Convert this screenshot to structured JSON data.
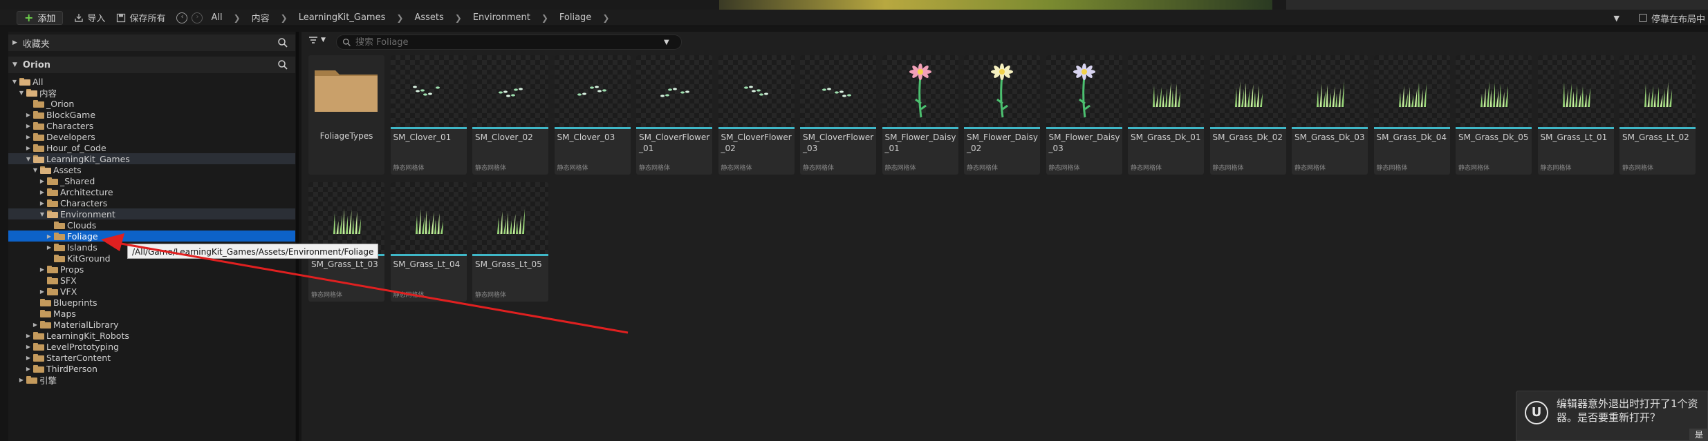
{
  "toolbar": {
    "add_label": "添加",
    "import_label": "导入",
    "save_all_label": "保存所有",
    "breadcrumbs": [
      "All",
      "内容",
      "LearningKit_Games",
      "Assets",
      "Environment",
      "Foliage"
    ],
    "dock_label": "停靠在布局中"
  },
  "left": {
    "favorites_label": "收藏夹",
    "root_label": "Orion",
    "tree": [
      {
        "label": "All",
        "depth": 0,
        "expanded": true,
        "arrow": "open"
      },
      {
        "label": "内容",
        "depth": 1,
        "expanded": true,
        "arrow": "open"
      },
      {
        "label": "_Orion",
        "depth": 2,
        "arrow": "none"
      },
      {
        "label": "BlockGame",
        "depth": 2,
        "arrow": "closed"
      },
      {
        "label": "Characters",
        "depth": 2,
        "arrow": "closed"
      },
      {
        "label": "Developers",
        "depth": 2,
        "arrow": "closed"
      },
      {
        "label": "Hour_of_Code",
        "depth": 2,
        "arrow": "closed"
      },
      {
        "label": "LearningKit_Games",
        "depth": 2,
        "arrow": "open",
        "highlight": true
      },
      {
        "label": "Assets",
        "depth": 3,
        "arrow": "open"
      },
      {
        "label": "_Shared",
        "depth": 4,
        "arrow": "closed"
      },
      {
        "label": "Architecture",
        "depth": 4,
        "arrow": "closed"
      },
      {
        "label": "Characters",
        "depth": 4,
        "arrow": "closed"
      },
      {
        "label": "Environment",
        "depth": 4,
        "arrow": "open",
        "highlight": true
      },
      {
        "label": "Clouds",
        "depth": 5,
        "arrow": "none"
      },
      {
        "label": "Foliage",
        "depth": 5,
        "arrow": "closed",
        "selected": true
      },
      {
        "label": "Islands",
        "depth": 5,
        "arrow": "closed"
      },
      {
        "label": "KitGround",
        "depth": 5,
        "arrow": "none"
      },
      {
        "label": "Props",
        "depth": 4,
        "arrow": "closed"
      },
      {
        "label": "SFX",
        "depth": 4,
        "arrow": "none"
      },
      {
        "label": "VFX",
        "depth": 4,
        "arrow": "closed"
      },
      {
        "label": "Blueprints",
        "depth": 3,
        "arrow": "none"
      },
      {
        "label": "Maps",
        "depth": 3,
        "arrow": "none"
      },
      {
        "label": "MaterialLibrary",
        "depth": 3,
        "arrow": "closed"
      },
      {
        "label": "LearningKit_Robots",
        "depth": 2,
        "arrow": "closed"
      },
      {
        "label": "LevelPrototyping",
        "depth": 2,
        "arrow": "closed"
      },
      {
        "label": "StarterContent",
        "depth": 2,
        "arrow": "closed"
      },
      {
        "label": "ThirdPerson",
        "depth": 2,
        "arrow": "closed"
      },
      {
        "label": "引擎",
        "depth": 1,
        "arrow": "closed"
      }
    ]
  },
  "content": {
    "search_placeholder": "搜索 Foliage",
    "folder_tile": {
      "name": "FoliageTypes"
    },
    "asset_type_label": "静态网格体",
    "assets": [
      {
        "name": "SM_Clover_01",
        "kind": "clover"
      },
      {
        "name": "SM_Clover_02",
        "kind": "clover"
      },
      {
        "name": "SM_Clover_03",
        "kind": "clover"
      },
      {
        "name": "SM_CloverFlower_01",
        "kind": "clover"
      },
      {
        "name": "SM_CloverFlower_02",
        "kind": "clover"
      },
      {
        "name": "SM_CloverFlower_03",
        "kind": "clover"
      },
      {
        "name": "SM_Flower_Daisy_01",
        "kind": "daisy",
        "petal": "#f2a0b8"
      },
      {
        "name": "SM_Flower_Daisy_02",
        "kind": "daisy",
        "petal": "#f5f0c0"
      },
      {
        "name": "SM_Flower_Daisy_03",
        "kind": "daisy",
        "petal": "#d8d4f0"
      },
      {
        "name": "SM_Grass_Dk_01",
        "kind": "grass"
      },
      {
        "name": "SM_Grass_Dk_02",
        "kind": "grass"
      },
      {
        "name": "SM_Grass_Dk_03",
        "kind": "grass"
      },
      {
        "name": "SM_Grass_Dk_04",
        "kind": "grass"
      },
      {
        "name": "SM_Grass_Dk_05",
        "kind": "grass"
      },
      {
        "name": "SM_Grass_Lt_01",
        "kind": "grass"
      },
      {
        "name": "SM_Grass_Lt_02",
        "kind": "grass"
      },
      {
        "name": "SM_Grass_Lt_03",
        "kind": "grass"
      },
      {
        "name": "SM_Grass_Lt_04",
        "kind": "grass"
      },
      {
        "name": "SM_Grass_Lt_05",
        "kind": "grass"
      }
    ]
  },
  "tooltip": {
    "text": "/All/Game/LearningKit_Games/Assets/Environment/Foliage"
  },
  "notification": {
    "message_line1": "编辑器意外退出时打开了1个资",
    "message_line2": "器。是否要重新打开？",
    "yes_label": "是"
  },
  "colors": {
    "selection": "#0d62c8",
    "asset_bar": "#3fb7c7",
    "folder": "#c49a5c",
    "annotation_arrow": "#e02020"
  }
}
